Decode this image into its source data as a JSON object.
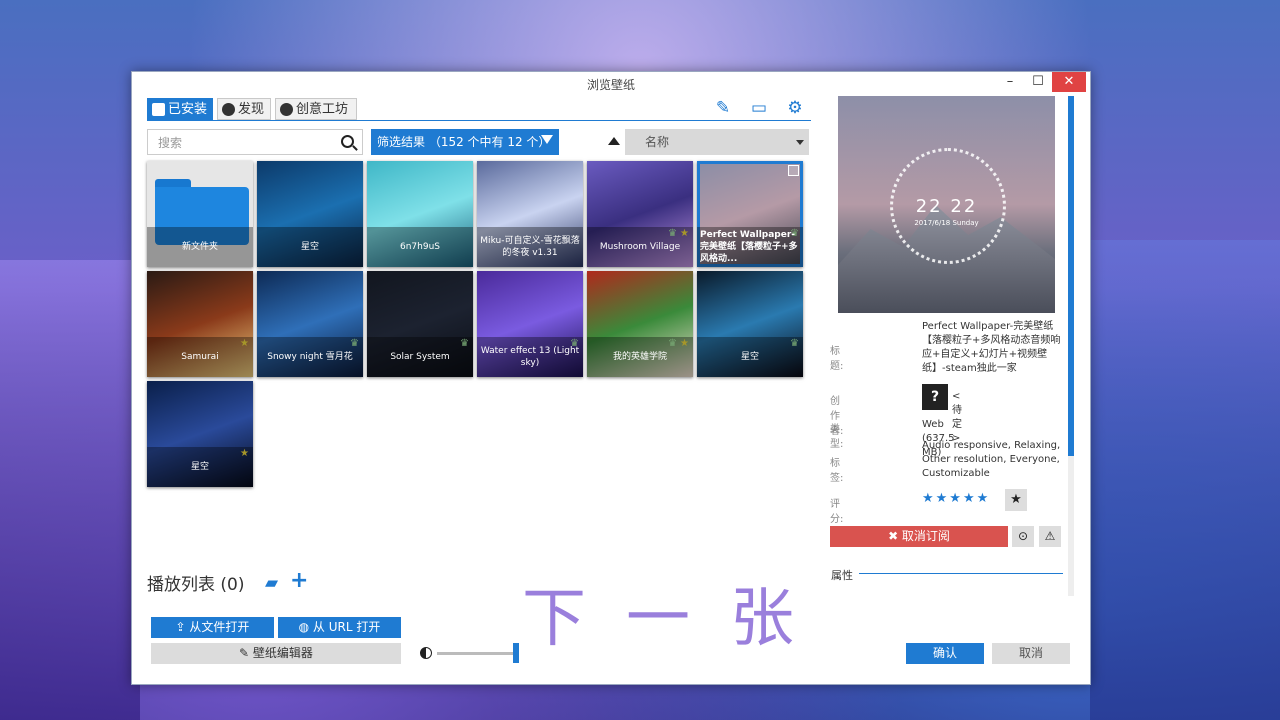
{
  "window": {
    "title": "浏览壁纸",
    "min": "–",
    "max": "☐",
    "close": "✕"
  },
  "tabs": [
    {
      "label": "已安装",
      "icon": "save-icon",
      "active": true
    },
    {
      "label": "发现",
      "icon": "compass-icon",
      "active": false
    },
    {
      "label": "创意工坊",
      "icon": "steam-icon",
      "active": false
    }
  ],
  "toolbar": {
    "editor_icon": "✎",
    "display_icon": "▭",
    "settings_icon": "⚙"
  },
  "search": {
    "placeholder": "搜索"
  },
  "filter": {
    "label": "筛选结果 （152 个中有 12 个）"
  },
  "sort": {
    "selected": "名称"
  },
  "wallpapers": [
    {
      "title": "新文件夹",
      "type": "folder"
    },
    {
      "title": "星空",
      "colors": [
        "#0c3a6a",
        "#1b6fb0",
        "#0a2444"
      ]
    },
    {
      "title": "6n7h9uS",
      "colors": [
        "#3fb7c7",
        "#7fe0e8",
        "#1a5f7a"
      ]
    },
    {
      "title": "Miku-可自定义-雪花飘落的冬夜 v1.31",
      "colors": [
        "#5a6a9c",
        "#c9d3f0",
        "#2a3563"
      ]
    },
    {
      "title": "Mushroom Village",
      "colors": [
        "#6a5bc0",
        "#3a2f80",
        "#c094e0"
      ],
      "trophy": true,
      "star": true
    },
    {
      "title": "Perfect Wallpaper-完美壁纸【落樱粒子+多风格动...",
      "colors": [
        "#8a8da6",
        "#b59aa6",
        "#3f434f"
      ],
      "selected": true,
      "trophy": true
    },
    {
      "title": "Samurai",
      "colors": [
        "#2a1a14",
        "#8a3a1a",
        "#f0d080"
      ],
      "star": true
    },
    {
      "title": "Snowy night 雪月花",
      "colors": [
        "#0d2a55",
        "#2f6fb8",
        "#0a1a3a"
      ],
      "trophy": true
    },
    {
      "title": "Solar System",
      "colors": [
        "#12161f",
        "#1c2230",
        "#0a0d14"
      ],
      "trophy": true
    },
    {
      "title": "Water effect 13 (Light sky)",
      "colors": [
        "#4a2a9a",
        "#7a5be0",
        "#1a1050"
      ],
      "trophy": true
    },
    {
      "title": "我的英雄学院",
      "colors": [
        "#b0281c",
        "#3a8a3a",
        "#f0e0d0"
      ],
      "trophy": true,
      "star": true
    },
    {
      "title": "星空",
      "colors": [
        "#0a1a2a",
        "#2a7ab0",
        "#0a0a14"
      ],
      "trophy": true
    },
    {
      "title": "星空",
      "colors": [
        "#0a1f4a",
        "#2a4a9a",
        "#050a1a"
      ],
      "star": true
    }
  ],
  "playlist": {
    "label": "播放列表 (0)",
    "folder_icon": "▰",
    "add_icon": "+"
  },
  "buttons": {
    "open_file": "从文件打开",
    "open_url": "从 URL 打开",
    "editor": "壁纸编辑器"
  },
  "overlay_text": "下一张",
  "preview": {
    "clock": "22 22",
    "date": "2017/6/18 Sunday"
  },
  "details": {
    "title_label": "标题:",
    "title_value": "Perfect Wallpaper-完美壁纸【落樱粒子+多风格动态音频响应+自定义+幻灯片+视频壁纸】-steam独此一家",
    "author_label": "创作者:",
    "author_value": "< 待定 >",
    "author_avatar": "?",
    "type_label": "类型:",
    "type_value": "Web (637.5 MB)",
    "tags_label": "标签:",
    "tags_value": "Audio responsive, Relaxing, Other resolution, Everyone, Customizable",
    "rating_label": "评分:",
    "rating": 5,
    "rating_stars": "★★★★★",
    "fav_icon": "★"
  },
  "actions": {
    "unsubscribe": "✖ 取消订阅",
    "steam_icon": "⊙",
    "warn_icon": "⚠"
  },
  "properties_label": "属性",
  "footer": {
    "ok": "确认",
    "cancel": "取消"
  }
}
